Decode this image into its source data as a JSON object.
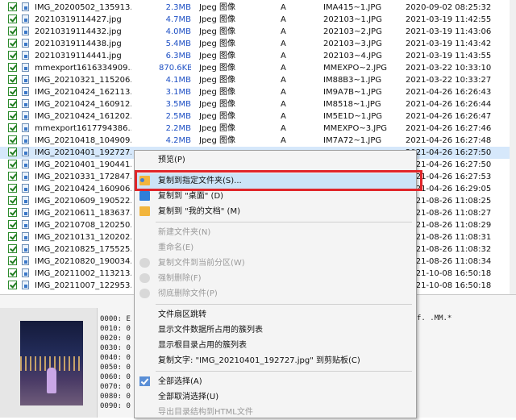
{
  "files": [
    {
      "name": "IMG_20200502_135913...",
      "size": "2.3MB",
      "type": "Jpeg 图像",
      "attr": "A",
      "short": "IMA415~1.JPG",
      "date": "2020-09-02 08:25:32"
    },
    {
      "name": "20210319114427.jpg",
      "size": "4.7MB",
      "type": "Jpeg 图像",
      "attr": "A",
      "short": "202103~1.JPG",
      "date": "2021-03-19 11:42:55"
    },
    {
      "name": "20210319114432.jpg",
      "size": "4.0MB",
      "type": "Jpeg 图像",
      "attr": "A",
      "short": "202103~2.JPG",
      "date": "2021-03-19 11:43:06"
    },
    {
      "name": "20210319114438.jpg",
      "size": "5.4MB",
      "type": "Jpeg 图像",
      "attr": "A",
      "short": "202103~3.JPG",
      "date": "2021-03-19 11:43:42"
    },
    {
      "name": "20210319114441.jpg",
      "size": "6.3MB",
      "type": "Jpeg 图像",
      "attr": "A",
      "short": "202103~4.JPG",
      "date": "2021-03-19 11:43:55"
    },
    {
      "name": "mmexport1616334909...",
      "size": "870.6KB",
      "type": "Jpeg 图像",
      "attr": "A",
      "short": "MMEXPO~2.JPG",
      "date": "2021-03-22 10:33:10"
    },
    {
      "name": "IMG_20210321_115206...",
      "size": "4.1MB",
      "type": "Jpeg 图像",
      "attr": "A",
      "short": "IM88B3~1.JPG",
      "date": "2021-03-22 10:33:27"
    },
    {
      "name": "IMG_20210424_162113...",
      "size": "3.1MB",
      "type": "Jpeg 图像",
      "attr": "A",
      "short": "IM9A7B~1.JPG",
      "date": "2021-04-26 16:26:43"
    },
    {
      "name": "IMG_20210424_160912...",
      "size": "3.5MB",
      "type": "Jpeg 图像",
      "attr": "A",
      "short": "IM8518~1.JPG",
      "date": "2021-04-26 16:26:44"
    },
    {
      "name": "IMG_20210424_161202...",
      "size": "2.5MB",
      "type": "Jpeg 图像",
      "attr": "A",
      "short": "IM5E1D~1.JPG",
      "date": "2021-04-26 16:26:47"
    },
    {
      "name": "mmexport1617794386...",
      "size": "2.2MB",
      "type": "Jpeg 图像",
      "attr": "A",
      "short": "MMEXPO~3.JPG",
      "date": "2021-04-26 16:27:46"
    },
    {
      "name": "IMG_20210418_104909...",
      "size": "4.2MB",
      "type": "Jpeg 图像",
      "attr": "A",
      "short": "IM7A72~1.JPG",
      "date": "2021-04-26 16:27:48"
    },
    {
      "name": "IMG_20210401_192727...",
      "size": "",
      "type": "",
      "attr": "",
      "short": "",
      "date": "2021-04-26 16:27:50"
    },
    {
      "name": "IMG_20210401_190441...",
      "size": "",
      "type": "",
      "attr": "",
      "short": "",
      "date": "2021-04-26 16:27:50"
    },
    {
      "name": "IMG_20210331_172847...",
      "size": "",
      "type": "",
      "attr": "",
      "short": "",
      "date": "2021-04-26 16:27:53"
    },
    {
      "name": "IMG_20210424_160906...",
      "size": "",
      "type": "",
      "attr": "",
      "short": "",
      "date": "2021-04-26 16:29:05"
    },
    {
      "name": "IMG_20210609_190522...",
      "size": "",
      "type": "",
      "attr": "",
      "short": "",
      "date": "2021-08-26 11:08:25"
    },
    {
      "name": "IMG_20210611_183637...",
      "size": "",
      "type": "",
      "attr": "",
      "short": "",
      "date": "2021-08-26 11:08:27"
    },
    {
      "name": "IMG_20210708_120250...",
      "size": "",
      "type": "",
      "attr": "",
      "short": "",
      "date": "2021-08-26 11:08:29"
    },
    {
      "name": "IMG_20210131_120202...",
      "size": "",
      "type": "",
      "attr": "",
      "short": "",
      "date": "2021-08-26 11:08:31"
    },
    {
      "name": "IMG_20210825_175525...",
      "size": "",
      "type": "",
      "attr": "",
      "short": "",
      "date": "2021-08-26 11:08:32"
    },
    {
      "name": "IMG_20210820_190034...",
      "size": "",
      "type": "",
      "attr": "",
      "short": "",
      "date": "2021-08-26 11:08:34"
    },
    {
      "name": "IMG_20211002_113213...",
      "size": "",
      "type": "",
      "attr": "",
      "short": "",
      "date": "2021-10-08 16:50:18"
    },
    {
      "name": "IMG_20211007_122953...",
      "size": "",
      "type": "",
      "attr": "",
      "short": "",
      "date": "2021-10-08 16:50:18"
    }
  ],
  "selected_row": 12,
  "preview": {
    "hex_lines": [
      "0000: E",
      "0010: 0",
      "0020: 0",
      "0030: 0",
      "0040: 0",
      "0050: 0",
      "0060: 0",
      "0070: 0",
      "0080: 0",
      "0090: 0"
    ],
    "ascii": "f. .MM.*"
  },
  "menu": {
    "items": [
      {
        "label": "预览(P)",
        "disabled": false,
        "icon": "",
        "highlighted": false
      },
      {
        "sep": true
      },
      {
        "label": "复制到指定文件夹(S)...",
        "disabled": false,
        "icon": "folder-star-icon",
        "highlighted": true
      },
      {
        "label": "复制到 \"桌面\" (D)",
        "disabled": false,
        "icon": "desktop-icon",
        "highlighted": false
      },
      {
        "label": "复制到 \"我的文档\" (M)",
        "disabled": false,
        "icon": "folder-icon",
        "highlighted": false
      },
      {
        "sep": true
      },
      {
        "label": "新建文件夹(N)",
        "disabled": true,
        "icon": "",
        "highlighted": false
      },
      {
        "label": "重命名(E)",
        "disabled": true,
        "icon": "",
        "highlighted": false
      },
      {
        "label": "复制文件到当前分区(W)",
        "disabled": true,
        "icon": "copy-partition-icon",
        "highlighted": false
      },
      {
        "label": "强制删除(F)",
        "disabled": true,
        "icon": "force-delete-icon",
        "highlighted": false
      },
      {
        "label": "彻底删除文件(P)",
        "disabled": true,
        "icon": "wipe-icon",
        "highlighted": false
      },
      {
        "sep": true
      },
      {
        "label": "文件扇区跳转",
        "disabled": false,
        "icon": "",
        "highlighted": false
      },
      {
        "label": "显示文件数据所占用的簇列表",
        "disabled": false,
        "icon": "",
        "highlighted": false
      },
      {
        "label": "显示根目录占用的簇列表",
        "disabled": false,
        "icon": "",
        "highlighted": false
      },
      {
        "label": "复制文字: \"IMG_20210401_192727.jpg\" 到剪贴板(C)",
        "disabled": false,
        "icon": "",
        "highlighted": false
      },
      {
        "sep": true
      },
      {
        "label": "全部选择(A)",
        "disabled": false,
        "icon": "check-icon",
        "highlighted": false
      },
      {
        "label": "全部取消选择(U)",
        "disabled": false,
        "icon": "",
        "highlighted": false
      },
      {
        "label": "导出目录结构到HTML文件",
        "disabled": true,
        "icon": "",
        "highlighted": false
      }
    ]
  },
  "colors": {
    "highlight_box": "#e0262a",
    "size_text": "#1d4fc4",
    "check_green": "#1e7a1e"
  }
}
